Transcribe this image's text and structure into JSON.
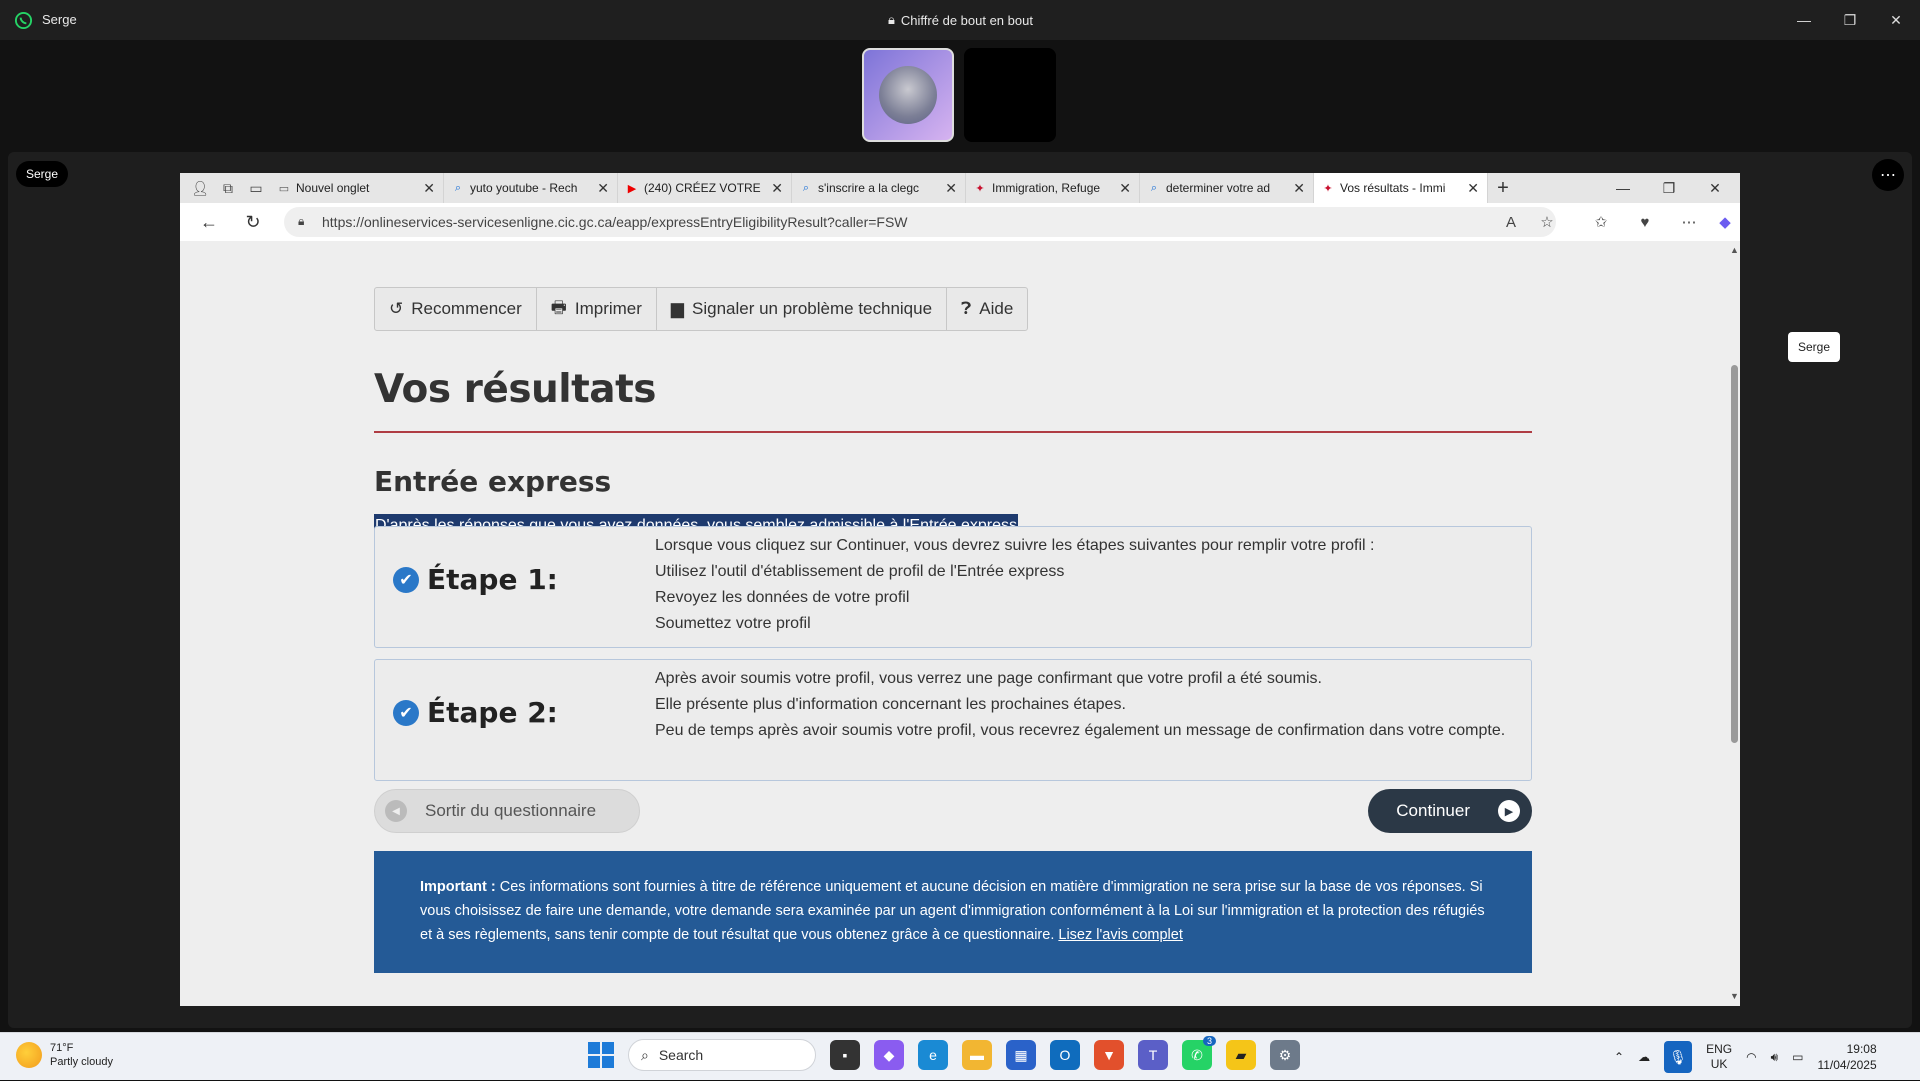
{
  "window": {
    "app_name": "Serge",
    "encryption_label": "Chiffré de bout en bout",
    "minimize": "—",
    "maximize": "❐",
    "close": "✕"
  },
  "call": {
    "name_badge": "Serge",
    "tooltip": "Serge",
    "more": "⋯"
  },
  "browser": {
    "tabs": [
      {
        "title": "Nouvel onglet",
        "icon": "page-icon"
      },
      {
        "title": "yuto youtube - Rech",
        "icon": "search-icon"
      },
      {
        "title": "(240) CRÉEZ VOTRE I",
        "icon": "youtube-icon"
      },
      {
        "title": "s'inscrire a la clegc",
        "icon": "search-icon"
      },
      {
        "title": "Immigration, Refuge",
        "icon": "maple-leaf-icon"
      },
      {
        "title": "determiner votre ad",
        "icon": "search-icon"
      },
      {
        "title": "Vos résultats - Immi",
        "icon": "maple-leaf-icon",
        "active": true
      }
    ],
    "url": "https://onlineservices-servicesenligne.cic.gc.ca/eapp/expressEntryEligibilityResult?caller=FSW"
  },
  "page": {
    "toolbar": {
      "restart": "Recommencer",
      "print": "Imprimer",
      "report": "Signaler un problème technique",
      "help": "Aide"
    },
    "title": "Vos résultats",
    "subtitle": "Entrée express",
    "eligibility_text": "D'après les réponses que vous avez données, vous semblez admissible à l'Entrée express",
    "step1": {
      "label": "Étape 1:",
      "lines": [
        "Lorsque vous cliquez sur Continuer, vous devrez suivre les étapes suivantes pour remplir votre profil :",
        "Utilisez l'outil d'établissement de profil de l'Entrée express",
        "Revoyez les données de votre profil",
        "Soumettez votre profil"
      ]
    },
    "step2": {
      "label": "Étape 2:",
      "lines": [
        "Après avoir soumis votre profil, vous verrez une page confirmant que votre profil a été soumis.",
        "Elle présente plus d'information concernant les prochaines étapes.",
        "Peu de temps après avoir soumis votre profil, vous recevrez également un message de confirmation dans votre compte."
      ]
    },
    "exit_button": "Sortir du questionnaire",
    "continue_button": "Continuer",
    "notice": {
      "bold": "Important :",
      "text": " Ces informations sont fournies à titre de référence uniquement et aucune décision en matière d'immigration ne sera prise sur la base de vos réponses. Si vous choisissez de faire une demande, votre demande sera examinée par un agent d'immigration conformément à la Loi sur l'immigration et la protection des réfugiés et à ses règlements, sans tenir compte de tout résultat que vous obtenez grâce à ce questionnaire. ",
      "link": "Lisez l'avis complet"
    }
  },
  "taskbar": {
    "temp": "71°F",
    "weather": "Partly cloudy",
    "search": "Search",
    "lang1": "ENG",
    "lang2": "UK",
    "time": "19:08",
    "date": "11/04/2025",
    "whatsapp_badge": "3"
  }
}
